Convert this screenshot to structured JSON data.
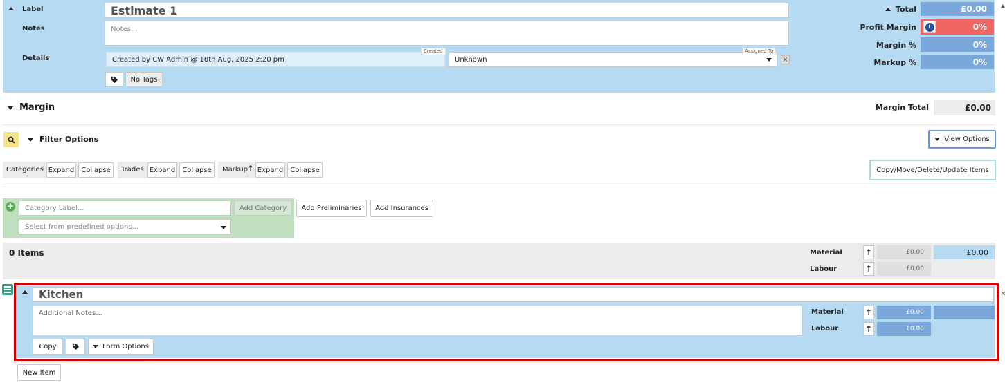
{
  "header": {
    "label_title": "Label",
    "label_value": "Estimate 1",
    "notes_title": "Notes",
    "notes_placeholder": "Notes...",
    "details_title": "Details",
    "created_badge": "Created",
    "created_text": "Created by  CW Admin @ 18th Aug, 2025 2:20 pm",
    "assigned_badge": "Assigned To",
    "assigned_value": "Unknown",
    "no_tags": "No Tags"
  },
  "totals": {
    "total_label": "Total",
    "total_value": "£0.00",
    "profit_margin_label": "Profit Margin",
    "profit_margin_value": "0%",
    "margin_pct_label": "Margin %",
    "margin_pct_value": "0%",
    "markup_pct_label": "Markup %",
    "markup_pct_value": "0%"
  },
  "margin": {
    "title": "Margin",
    "total_label": "Margin Total",
    "total_value": "£0.00"
  },
  "filter": {
    "title": "Filter Options",
    "view_options": "View Options"
  },
  "groups": {
    "categories": "Categories",
    "trades": "Trades",
    "markup": "Markup",
    "expand": "Expand",
    "collapse": "Collapse",
    "copy_move": "Copy/Move/Delete/Update Items"
  },
  "add_category": {
    "label_placeholder": "Category Label...",
    "add_button": "Add Category",
    "select_placeholder": "Select from predefined options...",
    "add_preliminaries": "Add Preliminaries",
    "add_insurances": "Add Insurances"
  },
  "items_summary": {
    "count": "0 Items",
    "material_label": "Material",
    "material_value": "£0.00",
    "material_total": "£0.00",
    "labour_label": "Labour",
    "labour_value": "£0.00"
  },
  "kitchen": {
    "title": "Kitchen",
    "notes_placeholder": "Additional Notes...",
    "copy": "Copy",
    "form_options": "Form Options",
    "material_label": "Material",
    "material_value": "£0.00",
    "labour_label": "Labour",
    "labour_value": "£0.00"
  },
  "new_item": "New Item",
  "colors": {
    "header_bg": "#b5daf2",
    "value_blue": "#7aa7d9",
    "profit_red": "#f06662",
    "add_category_green": "#bfdfbf",
    "highlight_red": "#d40000",
    "view_options_border": "#6a9ad0",
    "copy_move_border": "#a8dcdc"
  }
}
